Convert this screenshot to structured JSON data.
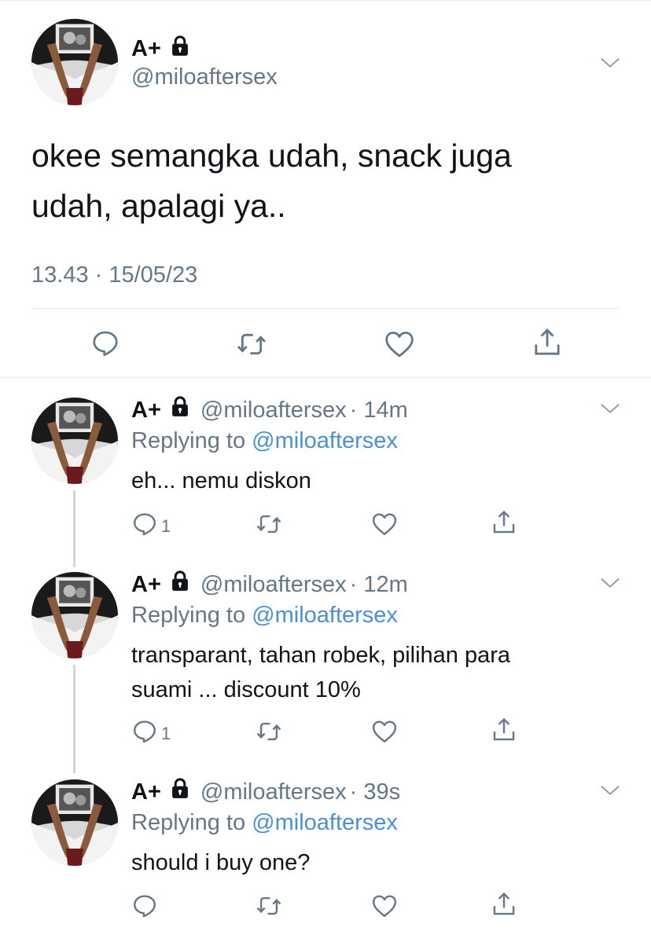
{
  "main": {
    "display_name": "A+",
    "handle": "@miloaftersex",
    "text": "okee semangka udah, snack juga udah, apalagi ya..",
    "timestamp": "13.43 · 15/05/23"
  },
  "replies": [
    {
      "display_name": "A+",
      "handle": "@miloaftersex",
      "time": "· 14m",
      "replying_prefix": "Replying to",
      "replying_to": "@miloaftersex",
      "text": "eh... nemu diskon",
      "reply_count": "1"
    },
    {
      "display_name": "A+",
      "handle": "@miloaftersex",
      "time": "· 12m",
      "replying_prefix": "Replying to",
      "replying_to": "@miloaftersex",
      "text": "transparant, tahan robek, pilihan para suami ... discount 10%",
      "reply_count": "1"
    },
    {
      "display_name": "A+",
      "handle": "@miloaftersex",
      "time": "· 39s",
      "replying_prefix": "Replying to",
      "replying_to": "@miloaftersex",
      "text": "should i buy one?",
      "reply_count": ""
    }
  ],
  "icons": {
    "reply": "comment-icon",
    "retweet": "retweet-icon",
    "like": "heart-icon",
    "share": "share-icon",
    "more": "chevron-down-icon",
    "protected": "lock-icon"
  },
  "colors": {
    "text": "#0f1419",
    "secondary": "#657786",
    "link": "#4a90d6",
    "divider": "#e1e8ed"
  }
}
